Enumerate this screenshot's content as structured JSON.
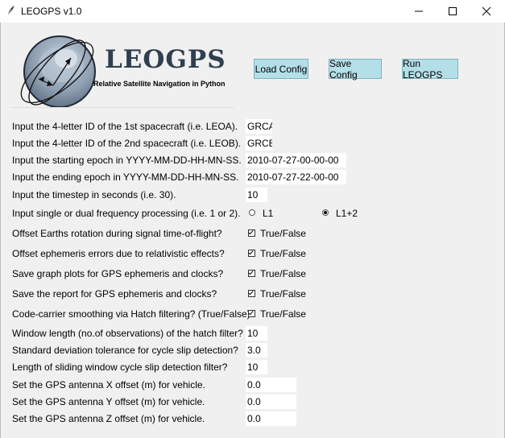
{
  "window": {
    "title": "LEOGPS v1.0"
  },
  "logo": {
    "wordmark": "LEOGPS",
    "subtitle": "Relative Satellite Navigation in Python"
  },
  "toolbar": {
    "load_label": "Load Config",
    "save_label": "Save Config",
    "run_label": "Run LEOGPS"
  },
  "fields": {
    "leoa": {
      "label": "Input the 4-letter ID of the 1st spacecraft (i.e. LEOA).",
      "value": "GRCA"
    },
    "leob": {
      "label": "Input the 4-letter ID of the 2nd spacecraft (i.e. LEOB).",
      "value": "GRCB"
    },
    "start_epoch": {
      "label": "Input the starting epoch in YYYY-MM-DD-HH-MN-SS.",
      "value": "2010-07-27-00-00-00"
    },
    "end_epoch": {
      "label": "Input the ending epoch in YYYY-MM-DD-HH-MN-SS.",
      "value": "2010-07-27-22-00-00"
    },
    "timestep": {
      "label": "Input the timestep in seconds (i.e. 30).",
      "value": "10"
    },
    "frequency": {
      "label": "Input single or dual frequency processing (i.e. 1 or 2).",
      "options": [
        "L1",
        "L1+2"
      ],
      "selected": "L1+2"
    },
    "earth_rotation": {
      "label": "Offset Earths rotation during signal time-of-flight?",
      "option": "True/False",
      "checked": true
    },
    "relativistic": {
      "label": "Offset ephemeris errors due to relativistic effects?",
      "option": "True/False",
      "checked": true
    },
    "graph_plots": {
      "label": "Save graph plots for GPS ephemeris and clocks?",
      "option": "True/False",
      "checked": true
    },
    "save_report": {
      "label": "Save the report for GPS ephemeris and clocks?",
      "option": "True/False",
      "checked": true
    },
    "hatch": {
      "label": "Code-carrier smoothing via Hatch filtering? (True/False)",
      "option": "True/False",
      "checked": true
    },
    "hatch_window": {
      "label": "Window length (no.of observations) of the hatch filter?",
      "value": "10"
    },
    "cycle_slip_sigma": {
      "label": "Standard deviation tolerance for cycle slip detection?",
      "value": "3.0"
    },
    "cycle_slip_window": {
      "label": "Length of sliding window cycle slip detection filter?",
      "value": "10"
    },
    "antenna_x": {
      "label": "Set the GPS antenna X offset (m) for vehicle.",
      "value": "0.0"
    },
    "antenna_y": {
      "label": "Set the GPS antenna Y offset (m) for vehicle.",
      "value": "0.0"
    },
    "antenna_z": {
      "label": "Set the GPS antenna Z offset (m) for vehicle.",
      "value": "0.0"
    }
  },
  "icons": {
    "app": "feather-icon",
    "minimize": "minimize-icon",
    "maximize": "maximize-icon",
    "close": "close-icon",
    "logo": "satellite-orbit-logo"
  },
  "colors": {
    "button_bg": "#b4dfe8",
    "window_bg": "#f0f0f0",
    "logo_text": "#2f3f4f"
  }
}
